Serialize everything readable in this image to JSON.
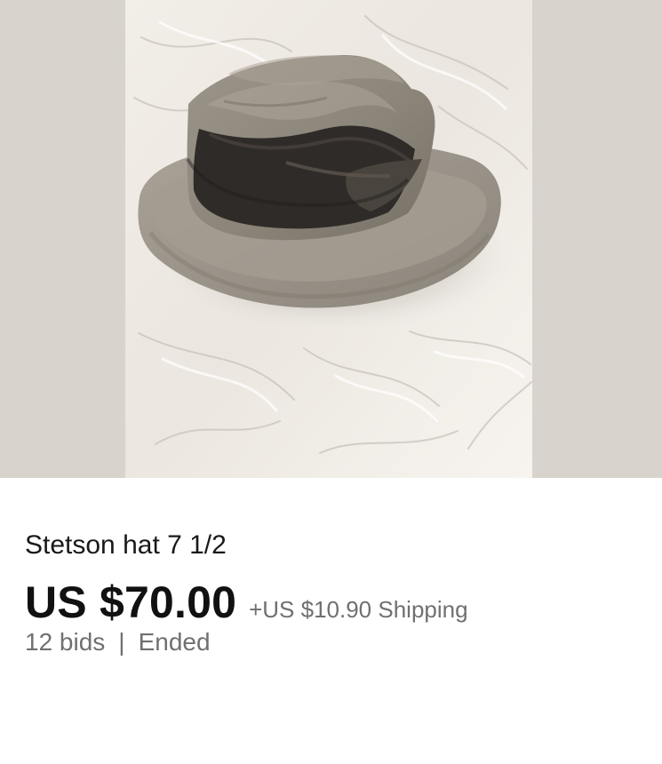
{
  "listing": {
    "image_alt": "Gray fedora hat on white fabric",
    "title": "Stetson hat 7 1/2",
    "price": "US $70.00",
    "shipping": "+US $10.90 Shipping",
    "bids": "12 bids",
    "separator": "|",
    "status": "Ended"
  },
  "colors": {
    "background": "#ffffff",
    "image_backdrop": "#d8d3cc",
    "primary_text": "#111111",
    "secondary_text": "#707070"
  }
}
